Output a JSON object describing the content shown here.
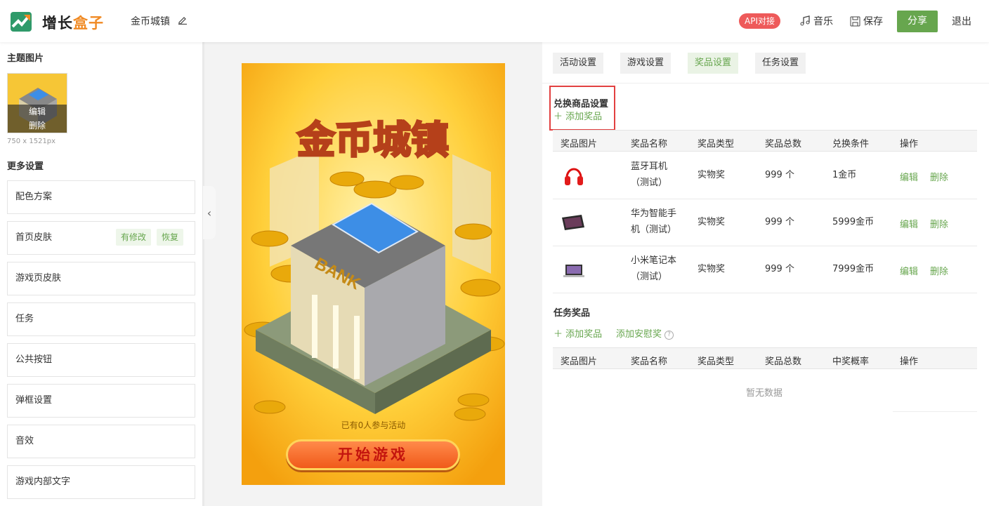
{
  "header": {
    "brand_main": "增长",
    "brand_accent": "盒子",
    "project_name": "金币城镇",
    "api_badge": "API对接",
    "music": "音乐",
    "save": "保存",
    "share": "分享",
    "quit": "退出"
  },
  "left": {
    "theme_image_title": "主题图片",
    "edit": "编辑",
    "delete": "删除",
    "dimensions": "750 x 1521px",
    "more_settings_title": "更多设置",
    "items": [
      {
        "label": "配色方案"
      },
      {
        "label": "首页皮肤",
        "tags": [
          "有修改",
          "恢复"
        ]
      },
      {
        "label": "游戏页皮肤"
      },
      {
        "label": "任务"
      },
      {
        "label": "公共按钮"
      },
      {
        "label": "弹框设置"
      },
      {
        "label": "音效"
      },
      {
        "label": "游戏内部文字"
      }
    ]
  },
  "preview": {
    "title": "金币城镇",
    "bank_sign": "BANK",
    "participants": "已有0人参与活动",
    "start_button": "开始游戏"
  },
  "tabs": [
    "活动设置",
    "游戏设置",
    "奖品设置",
    "任务设置"
  ],
  "active_tab": "奖品设置",
  "exchange": {
    "title": "兑换商品设置",
    "add_label": "添加奖品",
    "columns": [
      "奖品图片",
      "奖品名称",
      "奖品类型",
      "奖品总数",
      "兑换条件",
      "操作"
    ],
    "rows": [
      {
        "name_l1": "蓝牙耳机",
        "name_l2": "（测试）",
        "type": "实物奖",
        "total": "999 个",
        "condition": "1金币",
        "edit": "编辑",
        "delete": "删除",
        "icon": "headphones-icon"
      },
      {
        "name_l1": "华为智能手",
        "name_l2": "机（测试）",
        "type": "实物奖",
        "total": "999 个",
        "condition": "5999金币",
        "edit": "编辑",
        "delete": "删除",
        "icon": "smartphone-icon"
      },
      {
        "name_l1": "小米笔记本",
        "name_l2": "（测试）",
        "type": "实物奖",
        "total": "999 个",
        "condition": "7999金币",
        "edit": "编辑",
        "delete": "删除",
        "icon": "laptop-icon"
      }
    ]
  },
  "task_prizes": {
    "title": "任务奖品",
    "add_label": "添加奖品",
    "add_consolation_label": "添加安慰奖",
    "columns": [
      "奖品图片",
      "奖品名称",
      "奖品类型",
      "奖品总数",
      "中奖概率",
      "操作"
    ],
    "empty_text": "暂无数据"
  },
  "colors": {
    "accent_green": "#67a64e",
    "badge_red": "#ee5a5a",
    "brand_orange": "#f08a24",
    "highlight_red": "#e24040"
  }
}
